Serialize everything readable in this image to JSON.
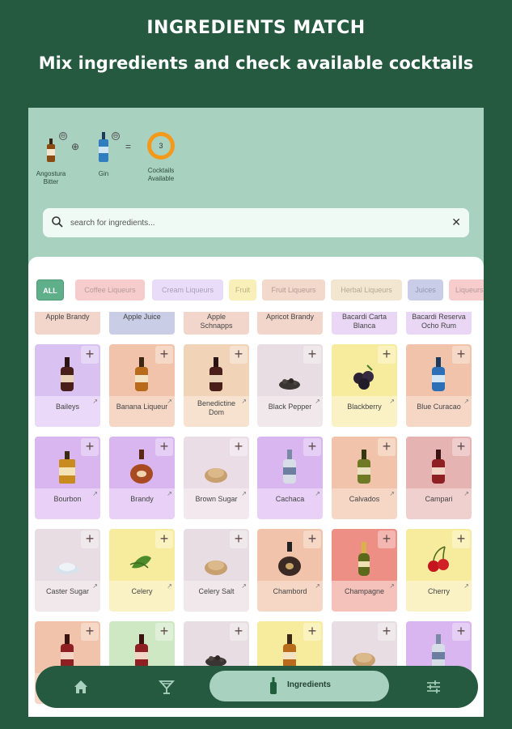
{
  "promo": {
    "title": "INGREDIENTS MATCH",
    "subtitle": "Mix ingredients and check available cocktails"
  },
  "mix": {
    "items": [
      {
        "label": "Angostura\nBitter",
        "icon": "bitters-bottle-icon"
      },
      {
        "label": "Gin",
        "icon": "gin-bottle-icon"
      }
    ],
    "plus_symbol": "⊕",
    "equals_symbol": "=",
    "remove_symbol": "⊖",
    "cocktails_count": "3",
    "cocktails_label": "Cocktails\nAvailable"
  },
  "search": {
    "placeholder": "search for ingredients...",
    "clear_symbol": "✕"
  },
  "categories": [
    {
      "label": "ALL",
      "bg": "#5fb08a",
      "fg": "#ffffff",
      "active": true
    },
    {
      "label": "Coffee Liqueurs",
      "bg": "#f6cccc",
      "fg": "#b79a9a",
      "active": false
    },
    {
      "label": "Cream Liqueurs",
      "bg": "#e8dcf8",
      "fg": "#a9a0bc",
      "active": false
    },
    {
      "label": "Fruit",
      "bg": "#f8f0b8",
      "fg": "#b9b085",
      "active": false
    },
    {
      "label": "Fruit Liqueurs",
      "bg": "#f3d8cc",
      "fg": "#b39c90",
      "active": false
    },
    {
      "label": "Herbal Liqueurs",
      "bg": "#f2e6d0",
      "fg": "#b4a891",
      "active": false
    },
    {
      "label": "Juices",
      "bg": "#c9cde8",
      "fg": "#9497b3",
      "active": false
    },
    {
      "label": "Liqueurs",
      "bg": "#f6cccc",
      "fg": "#b79a9a",
      "active": false
    }
  ],
  "partial_row": [
    {
      "name": "Apple Brandy",
      "bg": "#f3d6cb"
    },
    {
      "name": "Apple Juice",
      "bg": "#c9cde6"
    },
    {
      "name": "Apple\nSchnapps",
      "bg": "#f3d6cb"
    },
    {
      "name": "Apricot Brandy",
      "bg": "#f3d6cb"
    },
    {
      "name": "Bacardi Carta\nBlanca",
      "bg": "#ead7f6"
    },
    {
      "name": "Bacardi Reserva\nOcho Rum",
      "bg": "#ead7f6"
    }
  ],
  "ingredients": [
    {
      "name": "Baileys",
      "top": "#d9c2f2",
      "bottom": "#ead9f8",
      "icon": "liqueur-bottle-icon",
      "art": "bottle-dark"
    },
    {
      "name": "Banana Liqueur",
      "top": "#f1c3aa",
      "bottom": "#f6d7c6",
      "icon": "liqueur-bottle-icon",
      "art": "bottle-amber"
    },
    {
      "name": "Benedictine\nDom",
      "top": "#f1d3b8",
      "bottom": "#f6e2cf",
      "icon": "liqueur-bottle-icon",
      "art": "bottle-dark"
    },
    {
      "name": "Black Pepper",
      "top": "#e8dde2",
      "bottom": "#f1e8ec",
      "icon": "pepper-icon",
      "art": "pile-dark"
    },
    {
      "name": "Blackberry",
      "top": "#f7eb9d",
      "bottom": "#faf2c4",
      "icon": "blackberry-icon",
      "art": "berries"
    },
    {
      "name": "Blue Curacao",
      "top": "#f1c3aa",
      "bottom": "#f6d7c6",
      "icon": "curacao-bottle-icon",
      "art": "bottle-blue"
    },
    {
      "name": "Bourbon",
      "top": "#d9b6ef",
      "bottom": "#e8d0f6",
      "icon": "bourbon-bottle-icon",
      "art": "bottle-square"
    },
    {
      "name": "Brandy",
      "top": "#d9b6ef",
      "bottom": "#e8d0f6",
      "icon": "brandy-bottle-icon",
      "art": "bottle-round"
    },
    {
      "name": "Brown Sugar",
      "top": "#eadde6",
      "bottom": "#f2e8ee",
      "icon": "sugar-pile-icon",
      "art": "pile-tan"
    },
    {
      "name": "Cachaca",
      "top": "#d9b6ef",
      "bottom": "#e8d0f6",
      "icon": "cachaca-bottle-icon",
      "art": "bottle-clear"
    },
    {
      "name": "Calvados",
      "top": "#f1c3aa",
      "bottom": "#f6d7c6",
      "icon": "calvados-bottle-icon",
      "art": "bottle-green"
    },
    {
      "name": "Campari",
      "top": "#e6b3b3",
      "bottom": "#f0cfcf",
      "icon": "campari-bottle-icon",
      "art": "bottle-red"
    },
    {
      "name": "Caster Sugar",
      "top": "#e8dde2",
      "bottom": "#f1e8ec",
      "icon": "sugar-pile-icon",
      "art": "pile-white"
    },
    {
      "name": "Celery",
      "top": "#f7eb9d",
      "bottom": "#faf2c4",
      "icon": "celery-icon",
      "art": "leaf"
    },
    {
      "name": "Celery Salt",
      "top": "#e8dde2",
      "bottom": "#f1e8ec",
      "icon": "salt-pile-icon",
      "art": "pile-tan"
    },
    {
      "name": "Chambord",
      "top": "#f1c3aa",
      "bottom": "#f6d7c6",
      "icon": "chambord-bottle-icon",
      "art": "bottle-round-dark"
    },
    {
      "name": "Champagne",
      "top": "#ee8f86",
      "bottom": "#f5c1bb",
      "icon": "champagne-bottle-icon",
      "art": "bottle-champ"
    },
    {
      "name": "Cherry",
      "top": "#f7eb9d",
      "bottom": "#faf2c4",
      "icon": "cherry-icon",
      "art": "cherries"
    },
    {
      "name": "",
      "top": "#f1c3aa",
      "bottom": "#f6d7c6",
      "icon": "liqueur-bottle-icon",
      "art": "bottle-red"
    },
    {
      "name": "",
      "top": "#cfe8c4",
      "bottom": "#e2f2db",
      "icon": "liqueur-bottle-icon",
      "art": "bottle-red"
    },
    {
      "name": "",
      "top": "#e8dde2",
      "bottom": "#f1e8ec",
      "icon": "cinnamon-icon",
      "art": "pile-dark"
    },
    {
      "name": "",
      "top": "#f7eb9d",
      "bottom": "#faf2c4",
      "icon": "liqueur-bottle-icon",
      "art": "bottle-amber"
    },
    {
      "name": "",
      "top": "#e8dde2",
      "bottom": "#f1e8ec",
      "icon": "cinnamon-icon",
      "art": "pile-tan"
    },
    {
      "name": "",
      "top": "#d9b6ef",
      "bottom": "#e8d0f6",
      "icon": "liqueur-bottle-icon",
      "art": "bottle-clear"
    }
  ],
  "nav": {
    "home_icon": "home-icon",
    "cocktails_icon": "cocktail-glass-icon",
    "active_label": "Ingredients",
    "active_icon": "bottle-icon",
    "filters_icon": "sliders-icon"
  }
}
